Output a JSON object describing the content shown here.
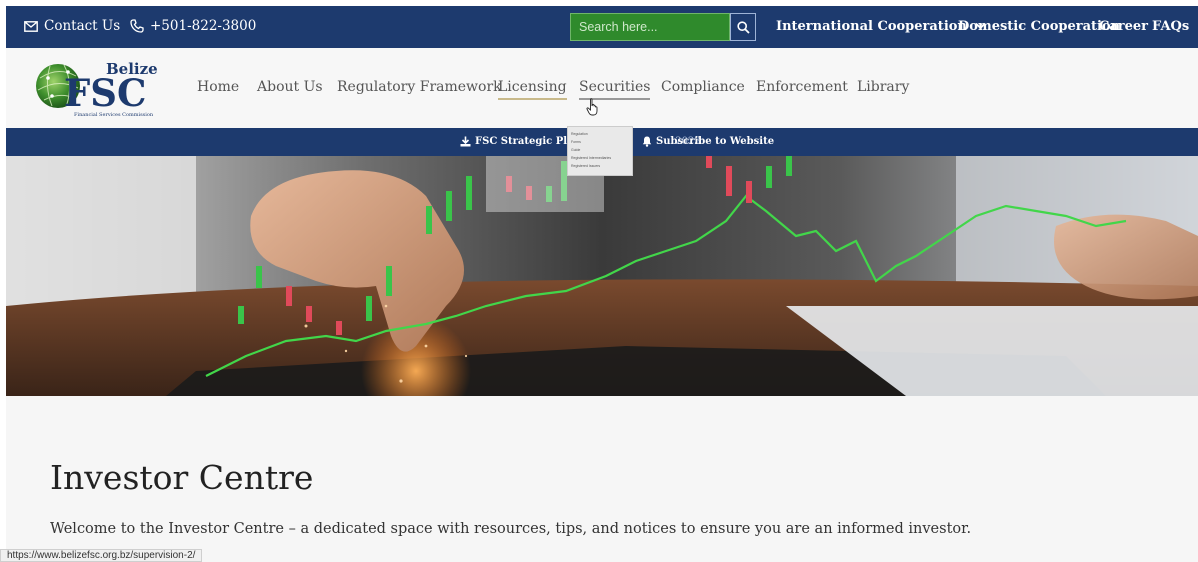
{
  "topbar": {
    "contact_label": "Contact Us",
    "phone": "+501-822-3800",
    "search_placeholder": "Search here...",
    "international": "International Cooperation",
    "domestic": "Domestic Cooperation",
    "career": "Career",
    "faqs": "FAQs"
  },
  "logo": {
    "belize": "Belize",
    "fsc": "FSC",
    "subtitle": "Financial Services Commission"
  },
  "nav": {
    "home": "Home",
    "about": "About Us",
    "regulatory": "Regulatory Framework",
    "licensing": "Licensing",
    "securities": "Securities",
    "compliance": "Compliance",
    "enforcement": "Enforcement",
    "library": "Library"
  },
  "strip": {
    "plan": "FSC Strategic Plan 2",
    "plan_years": "2023",
    "subscribe": "Subscribe to Website"
  },
  "dropdown": {
    "items": [
      "Regulation",
      "Forms",
      "Guide",
      "Registered Intermediaries",
      "Registered Issuers"
    ]
  },
  "main": {
    "title": "Investor Centre",
    "intro": "Welcome to the Investor Centre – a dedicated space with resources, tips, and notices to ensure you are an informed investor."
  },
  "status_url": "https://www.belizefsc.org.bz/supervision-2/",
  "colors": {
    "navy": "#1d3a6e",
    "search_green": "#2f8a2c",
    "logo_blue": "#1d3a6e"
  }
}
